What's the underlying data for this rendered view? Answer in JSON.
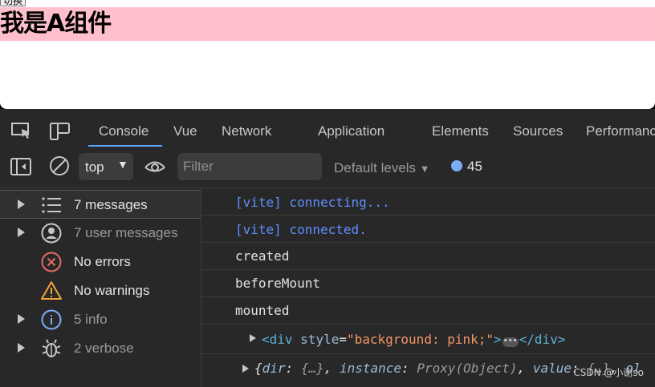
{
  "page": {
    "switch_button": "切换",
    "heading": "我是A组件",
    "bar_color": "#ffc0cb"
  },
  "devtools": {
    "tabs": [
      "Console",
      "Vue",
      "Network",
      "Application",
      "Elements",
      "Sources",
      "Performanc"
    ],
    "active_tab": "Console",
    "context": "top",
    "filter_placeholder": "Filter",
    "levels": "Default levels",
    "issues_count": "45",
    "sidebar": [
      {
        "label": "7 messages",
        "icon": "list-icon",
        "expandable": true,
        "selected": true
      },
      {
        "label": "7 user messages",
        "icon": "user-icon",
        "expandable": true,
        "selected": false
      },
      {
        "label": "No errors",
        "icon": "error-icon",
        "expandable": false,
        "selected": false
      },
      {
        "label": "No warnings",
        "icon": "warning-icon",
        "expandable": false,
        "selected": false
      },
      {
        "label": "5 info",
        "icon": "info-icon",
        "expandable": true,
        "selected": false
      },
      {
        "label": "2 verbose",
        "icon": "bug-icon",
        "expandable": true,
        "selected": false
      }
    ],
    "messages": [
      {
        "text": "[vite] connecting...",
        "style": "blue"
      },
      {
        "text": "[vite] connected.",
        "style": "blue"
      },
      {
        "text": "created",
        "style": "plain"
      },
      {
        "text": "beforeMount",
        "style": "plain"
      },
      {
        "text": "mounted",
        "style": "plain"
      }
    ],
    "element_node": {
      "open_tag": "<div",
      "attr_name": "style",
      "attr_value": "\"background: pink;\"",
      "close_tag": "</div>"
    },
    "object_node": {
      "k1": "dir",
      "v1": "{…}",
      "k2": "instance",
      "v2": "Proxy(Object)",
      "k3": "value",
      "v3": "{…}",
      "k4": "ol"
    },
    "colors": {
      "accent": "#5da3ff",
      "panel": "#282828"
    }
  },
  "watermark": "CSDN @小谢so"
}
